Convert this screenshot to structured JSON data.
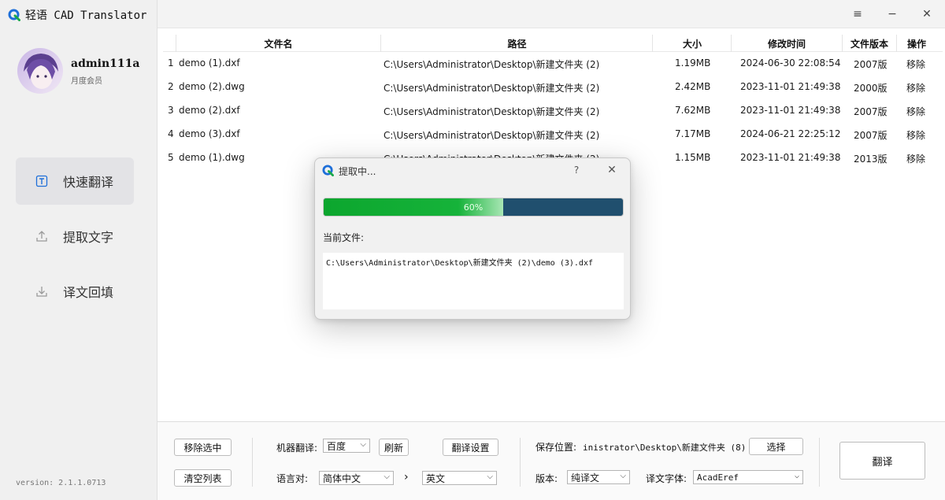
{
  "app": {
    "title": "轻语 CAD Translator",
    "version": "version: 2.1.1.0713"
  },
  "user": {
    "name": "admin111a",
    "level": "月度会员"
  },
  "nav": [
    {
      "label": "快速翻译",
      "icon": "translate-icon",
      "active": true
    },
    {
      "label": "提取文字",
      "icon": "upload-icon",
      "active": false
    },
    {
      "label": "译文回填",
      "icon": "download-icon",
      "active": false
    }
  ],
  "window_controls": {
    "menu": "≡",
    "minimize": "−",
    "close": "✕"
  },
  "table": {
    "headers": [
      "文件名",
      "路径",
      "大小",
      "修改时间",
      "文件版本",
      "操作"
    ],
    "rows": [
      {
        "index": "1",
        "name": "demo (1).dxf",
        "path": "C:\\Users\\Administrator\\Desktop\\新建文件夹 (2)",
        "size": "1.19MB",
        "time": "2024-06-30 22:08:54",
        "version": "2007版",
        "action": "移除"
      },
      {
        "index": "2",
        "name": "demo (2).dwg",
        "path": "C:\\Users\\Administrator\\Desktop\\新建文件夹 (2)",
        "size": "2.42MB",
        "time": "2023-11-01 21:49:38",
        "version": "2000版",
        "action": "移除"
      },
      {
        "index": "3",
        "name": "demo (2).dxf",
        "path": "C:\\Users\\Administrator\\Desktop\\新建文件夹 (2)",
        "size": "7.62MB",
        "time": "2023-11-01 21:49:38",
        "version": "2007版",
        "action": "移除"
      },
      {
        "index": "4",
        "name": "demo (3).dxf",
        "path": "C:\\Users\\Administrator\\Desktop\\新建文件夹 (2)",
        "size": "7.17MB",
        "time": "2024-06-21 22:25:12",
        "version": "2007版",
        "action": "移除"
      },
      {
        "index": "5",
        "name": "demo (1).dwg",
        "path": "C:\\Users\\Administrator\\Desktop\\新建文件夹 (2)",
        "size": "1.15MB",
        "time": "2023-11-01 21:49:38",
        "version": "2013版",
        "action": "移除"
      }
    ]
  },
  "bottom": {
    "remove_selected": "移除选中",
    "clear_list": "清空列表",
    "machine_label": "机器翻译:",
    "machine_value": "百度",
    "refresh": "刷新",
    "settings": "翻译设置",
    "lang_label": "语言对:",
    "lang_from": "简体中文",
    "lang_arrow": "›",
    "lang_to": "英文",
    "save_label": "保存位置:",
    "save_path": "inistrator\\Desktop\\新建文件夹 (8)",
    "choose": "选择",
    "edition_label": "版本:",
    "edition_value": "纯译文",
    "font_label": "译文字体:",
    "font_value": "AcadEref",
    "translate": "翻译"
  },
  "dialog": {
    "title": "提取中...",
    "help": "?",
    "close": "✕",
    "progress_percent": 60,
    "progress_text": "60%",
    "current_label": "当前文件:",
    "current_path": "C:\\Users\\Administrator\\Desktop\\新建文件夹 (2)\\demo (3).dxf"
  },
  "colors": {
    "progress_fill": "#16b33a",
    "progress_track": "#204f6e",
    "logo_blue": "#1e6fd9",
    "logo_green": "#19a84a",
    "nav_active": "#e3e3e6"
  }
}
